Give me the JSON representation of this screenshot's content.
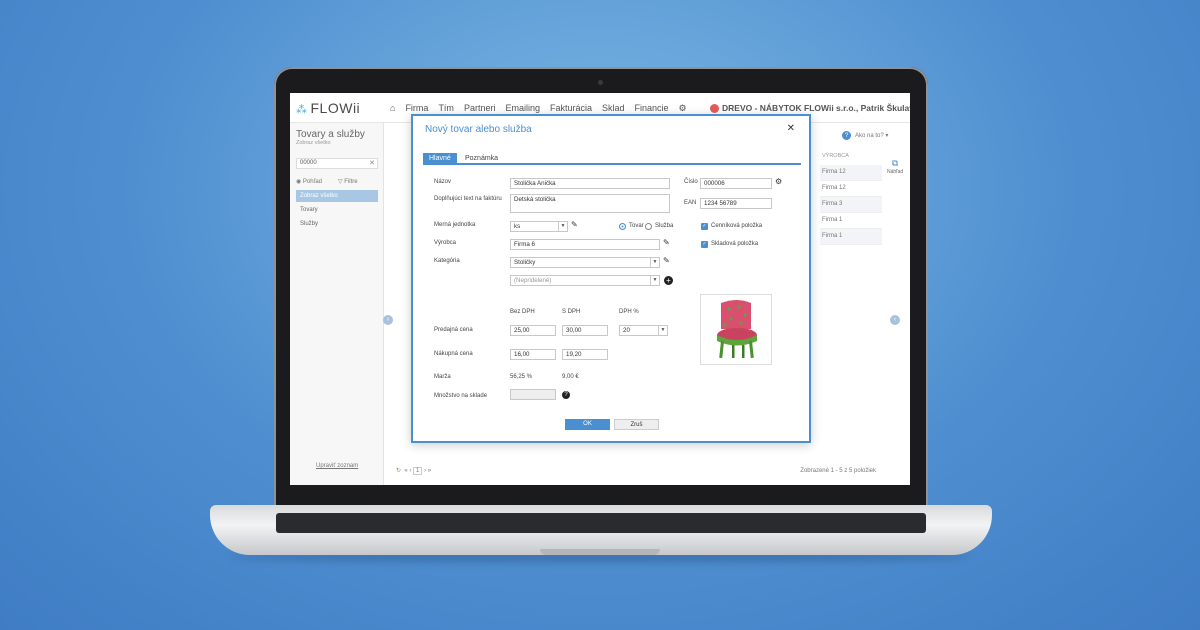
{
  "app": {
    "logo": "FLOWii",
    "nav": [
      "Firma",
      "Tím",
      "Partneri",
      "Emailing",
      "Fakturácia",
      "Sklad",
      "Financie"
    ],
    "company": "DREVO - NÁBYTOK FLOWii s.r.o., Patrik Škulavík"
  },
  "left_panel": {
    "title": "Tovary a služby",
    "subtitle": "Zobraz všetko",
    "search_value": "00000",
    "tab_view": "Pohľad",
    "tab_filter": "Filtre",
    "items": [
      "Zobraz všetko",
      "Tovary",
      "Služby"
    ],
    "footer": "Upraviť zoznam"
  },
  "right": {
    "help": "Ako na to?",
    "column_header": "VÝROBCA",
    "rows": [
      "Firma 12",
      "Firma 12",
      "Firma 3",
      "Firma 1",
      "Firma 1"
    ],
    "preview": "Náhľad"
  },
  "bottom": {
    "page": "1",
    "status": "Zobrazené 1 - 5 z 5 položiek"
  },
  "modal": {
    "title": "Nový tovar alebo služba",
    "tabs": [
      "Hlavné",
      "Poznámka"
    ],
    "labels": {
      "name": "Názov",
      "invoice_text": "Doplňujúci text na faktúru",
      "unit": "Merná jednotka",
      "manufacturer": "Výrobca",
      "category": "Kategória",
      "number": "Číslo",
      "ean": "EAN",
      "goods": "Tovar",
      "service": "Služba",
      "pricelist": "Cenníková položka",
      "stock_item": "Skladová položka",
      "without_vat": "Bez DPH",
      "with_vat": "S DPH",
      "vat_pct": "DPH %",
      "sale_price": "Predajná cena",
      "purchase_price": "Nákupná cena",
      "margin": "Marža",
      "stock_qty": "Množstvo na sklade"
    },
    "values": {
      "name": "Stolička Anička",
      "invoice_text": "Detská stolička",
      "unit": "ks",
      "manufacturer": "Firma 6",
      "category": "Stoličky",
      "subcategory_placeholder": "(Nepridelené)",
      "number": "000006",
      "ean": "1234 56789",
      "sale_without_vat": "25,00",
      "sale_with_vat": "30,00",
      "vat": "20",
      "purchase_without_vat": "16,00",
      "purchase_with_vat": "19,20",
      "margin_pct": "56,25 %",
      "margin_eur": "9,00 €"
    },
    "ok": "OK",
    "cancel": "Zruš"
  },
  "colors": {
    "accent": "#4a8fd0",
    "chair_seat": "#d94f6f",
    "chair_legs": "#5da53a"
  }
}
